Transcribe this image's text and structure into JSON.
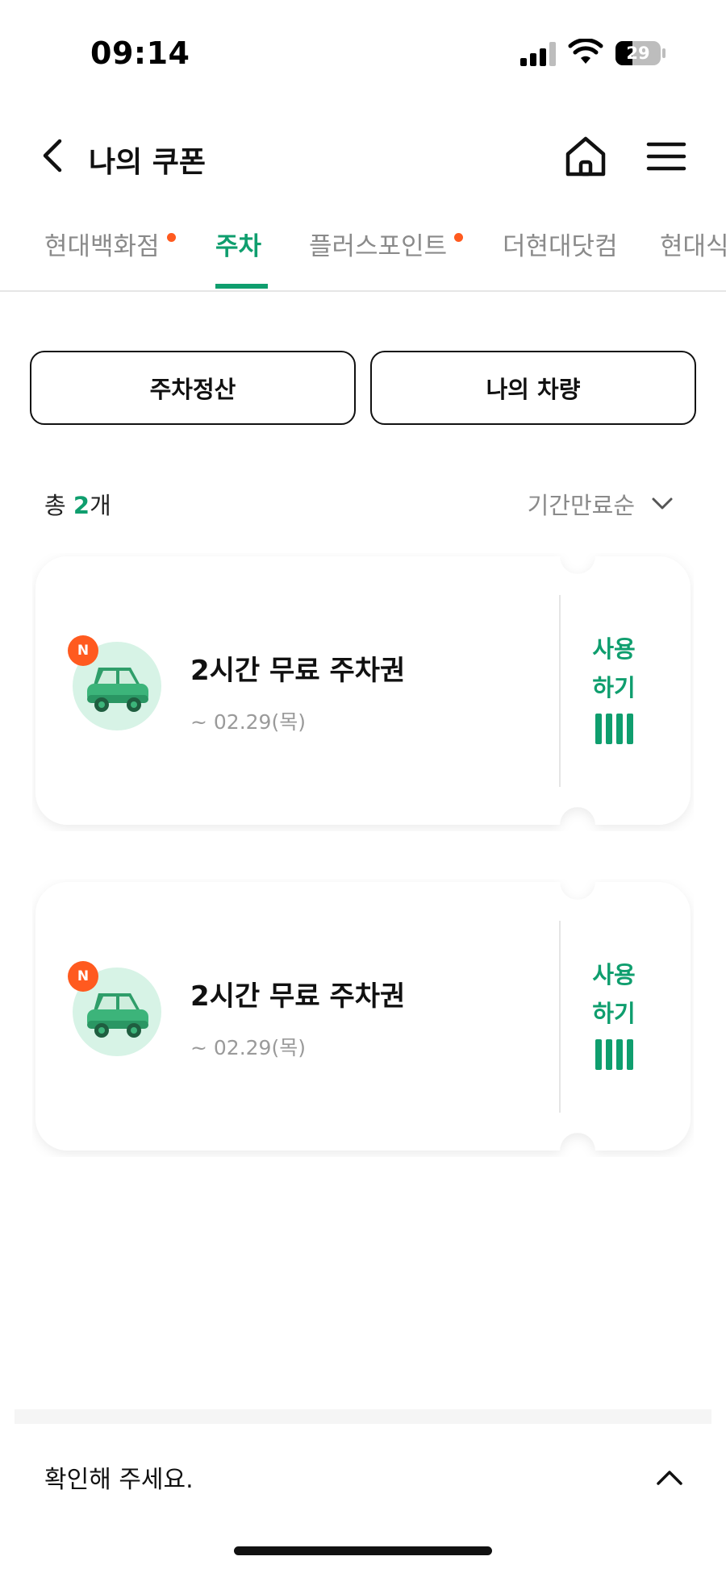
{
  "status_bar": {
    "time": "09:14",
    "battery": "29"
  },
  "header": {
    "title": "나의 쿠폰"
  },
  "tabs": [
    {
      "label": "현대백화점",
      "new": true
    },
    {
      "label": "주차",
      "active": true
    },
    {
      "label": "플러스포인트",
      "new": true
    },
    {
      "label": "더현대닷컴"
    },
    {
      "label": "현대식품관"
    }
  ],
  "actions": {
    "parking_payment": "주차정산",
    "my_vehicle": "나의 차량"
  },
  "summary": {
    "prefix": "총 ",
    "count": "2",
    "suffix": "개"
  },
  "sort": {
    "label": "기간만료순"
  },
  "coupons": [
    {
      "badge": "N",
      "title": "2시간 무료 주차권",
      "date": "~ 02.29(목)",
      "use_line1": "사용",
      "use_line2": "하기"
    },
    {
      "badge": "N",
      "title": "2시간 무료 주차권",
      "date": "~ 02.29(목)",
      "use_line1": "사용",
      "use_line2": "하기"
    }
  ],
  "notice": {
    "label": "확인해 주세요."
  },
  "colors": {
    "accent": "#0f9e6e",
    "badge": "#ff5a1f",
    "icon_bg": "#d7f3e6"
  }
}
